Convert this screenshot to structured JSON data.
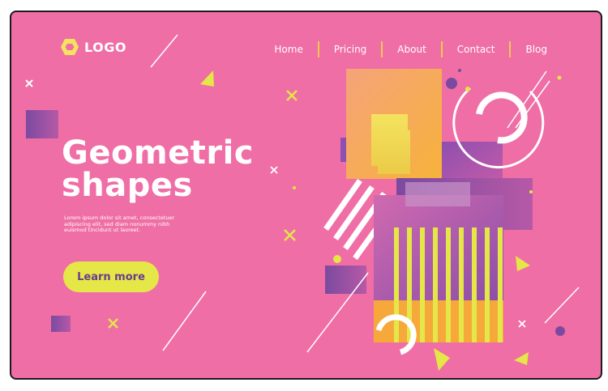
{
  "brand": {
    "logo_text": "LOGO"
  },
  "nav": {
    "items": [
      "Home",
      "Pricing",
      "About",
      "Contact",
      "Blog"
    ]
  },
  "hero": {
    "title_line1": "Geometric",
    "title_line2": "shapes",
    "body": "Lorem ipsum dolor sit amet, consectetuer adipiscing elit, sed diam nonummy nibh euismod tincidunt ut laoreet.",
    "cta_label": "Learn more"
  },
  "colors": {
    "background": "#EF6EA5",
    "accent_yellow": "#E5E647",
    "accent_purple": "#7B4AA0",
    "accent_orange": "#F6A93A"
  }
}
